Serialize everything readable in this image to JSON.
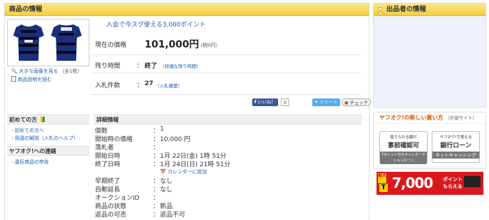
{
  "main": {
    "header": "商品の情報",
    "promo_link": "入会で今スグ使える3,000ポイント",
    "photo_links": {
      "large_image": "大きな画像を見る",
      "image_count": "（全1枚）",
      "description": "商品説明を読む"
    },
    "price": {
      "label": "現在の価格",
      "value": "101,000円",
      "tax": "（税0円）"
    },
    "time_left": {
      "label": "残り時間",
      "colon": "：",
      "value": "終了",
      "detail_link": "（詳細な残り時間）"
    },
    "bids": {
      "label": "入札件数",
      "colon": "：",
      "value": "27",
      "history_link": "（入札履歴）"
    },
    "share": {
      "like": "いいね！",
      "like_count": "0",
      "tweet": "ツイート",
      "check": "チェック"
    }
  },
  "sidebar": {
    "sections": [
      {
        "title": "初めての方",
        "links": [
          "初めての方へ",
          "用語の解説（入札のヘルプ）"
        ]
      },
      {
        "title": "ヤフオク!への連絡",
        "links": [
          "違反商品の申告"
        ]
      }
    ]
  },
  "details": {
    "header": "詳細情報",
    "calendar_link": "カレンダーに追加",
    "rows": [
      {
        "key": "個数",
        "value": "1"
      },
      {
        "key": "開始時の価格",
        "value": "10,000 円"
      },
      {
        "key": "落札者",
        "value": ""
      },
      {
        "key": "開始日時",
        "value": "1月 22日(金) 1時 51分"
      },
      {
        "key": "終了日時",
        "value": "1月 24日(日) 21時 51分"
      },
      {
        "key": "早期終了",
        "value": "なし"
      },
      {
        "key": "自動延長",
        "value": "なし"
      },
      {
        "key": "オークションID",
        "value": ""
      },
      {
        "key": "商品の状態",
        "value": "新品"
      },
      {
        "key": "返品の可否",
        "value": "返品不可"
      }
    ],
    "colon": "："
  },
  "seller": {
    "header": "出品者の情報"
  },
  "new_way": {
    "title": "ヤフオク!の新しい買い方",
    "external": "（外部サイト）",
    "ad1": {
      "line1": "借りられる額が",
      "line2": "事前確認可",
      "line3": "Tポイント付きネットオークションローン"
    },
    "ad2": {
      "line1": "ヤフオク!で使える",
      "line2": "銀行ローン",
      "line3": "ネットキャッシング"
    }
  },
  "banner": {
    "prefix": "最大",
    "amount": "7,000",
    "suffix1": "ポイント",
    "suffix2": "もらえる"
  },
  "colors": {
    "header_yellow": "#f4cf3f",
    "link": "#1a5fb4",
    "banner_red": "#d7191f",
    "accent_orange": "#d05a00"
  }
}
